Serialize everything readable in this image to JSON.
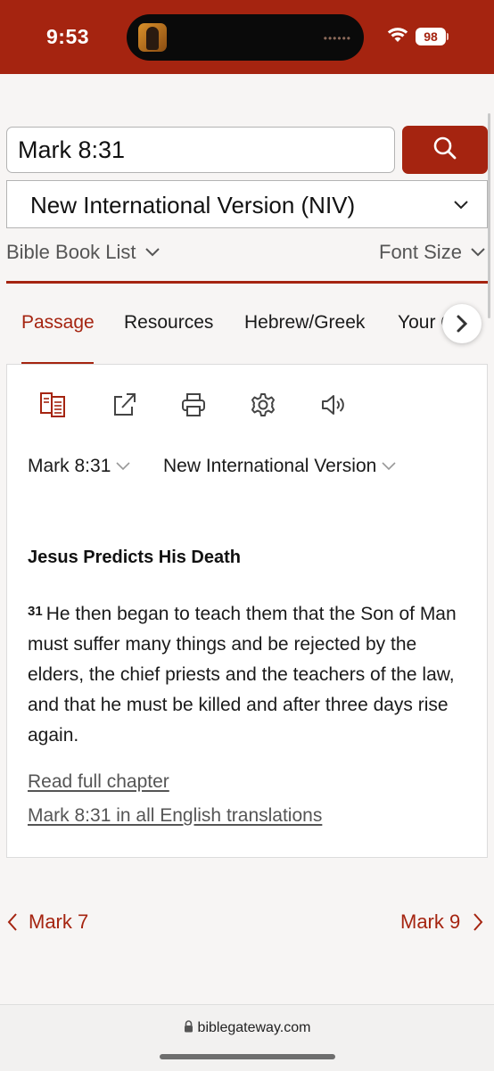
{
  "status_bar": {
    "time": "9:53",
    "battery": "98",
    "island_dots": "••••••",
    "bg_color": "#a52410"
  },
  "search": {
    "value": "Mark 8:31",
    "button_icon": "search-icon"
  },
  "version_select": {
    "label": "New International Version (NIV)"
  },
  "bible_book_list": "Bible Book List",
  "font_size": "Font Size",
  "tabs": [
    {
      "label": "Passage",
      "active": true
    },
    {
      "label": "Resources",
      "active": false
    },
    {
      "label": "Hebrew/Greek",
      "active": false
    },
    {
      "label": "Your C",
      "active": false
    }
  ],
  "toolbar_icons": [
    "parallel-icon",
    "share-icon",
    "print-icon",
    "settings-icon",
    "audio-icon"
  ],
  "passage": {
    "reference": "Mark 8:31",
    "version": "New International Version",
    "heading": "Jesus Predicts His Death",
    "verse_number": "31",
    "verse_text": "He then began to teach them that the Son of Man must suffer many things and be rejected by the elders, the chief priests and the teachers of the law, and that he must be killed and after three days rise again.",
    "read_full_chapter": "Read full chapter",
    "all_translations": "Mark 8:31 in all English translations"
  },
  "chapter_nav": {
    "prev": "Mark 7",
    "next": "Mark 9"
  },
  "browser": {
    "url": "biblegateway.com"
  },
  "colors": {
    "accent": "#a52410",
    "link_gray": "#555555"
  }
}
